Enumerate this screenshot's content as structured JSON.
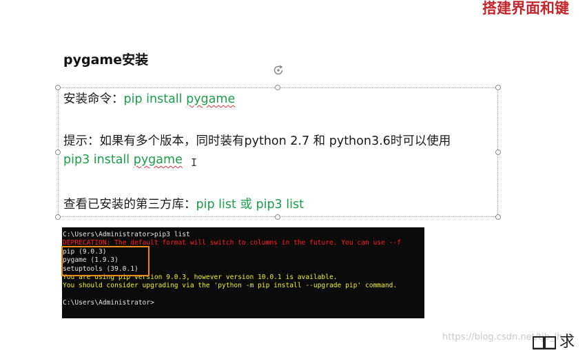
{
  "header": {
    "title": "搭建界面和键"
  },
  "slide": {
    "heading": "pygame安装",
    "install_label": "安装命令：",
    "install_cmd_prefix": "pip install ",
    "install_cmd_pkg": "pygame",
    "tip_text": "提示：如果有多个版本，同时装有python 2.7 和 python3.6时可以使用",
    "pip3_cmd_prefix": "pip3 install ",
    "pip3_cmd_pkg": "pygame",
    "cursor_glyph": "I",
    "list_label": "查看已安装的第三方库：",
    "list_cmd": "pip list 或 pip3 list"
  },
  "terminal": {
    "lines": [
      {
        "text": "C:\\Users\\Administrator>pip3 list",
        "color": "white"
      },
      {
        "text": "DEPRECATION: The default format will switch to columns in the future. You can use --f",
        "color": "red"
      },
      {
        "text": "pip (9.0.3)",
        "color": "white"
      },
      {
        "text": "pygame (1.9.3)",
        "color": "white"
      },
      {
        "text": "setuptools (39.0.1)",
        "color": "white"
      },
      {
        "text": "You are using pip version 9.0.3, however version 10.0.1 is available.",
        "color": "yellow"
      },
      {
        "text": "You should consider upgrading via the 'python -m pip install --upgrade pip' command.",
        "color": "yellow"
      },
      {
        "text": "",
        "color": "white"
      },
      {
        "text": "C:\\Users\\Administrator>",
        "color": "white"
      }
    ]
  },
  "watermark": {
    "text": "https://blog.csdn.net/tjb_lh"
  },
  "footer": {
    "text": "求"
  },
  "colors": {
    "accent_red": "#c0272d",
    "command_green": "#1e9a4b",
    "highlight_orange": "#f08a1a"
  },
  "icons": {
    "rotate": "rotate-icon",
    "book": "book-icon"
  }
}
